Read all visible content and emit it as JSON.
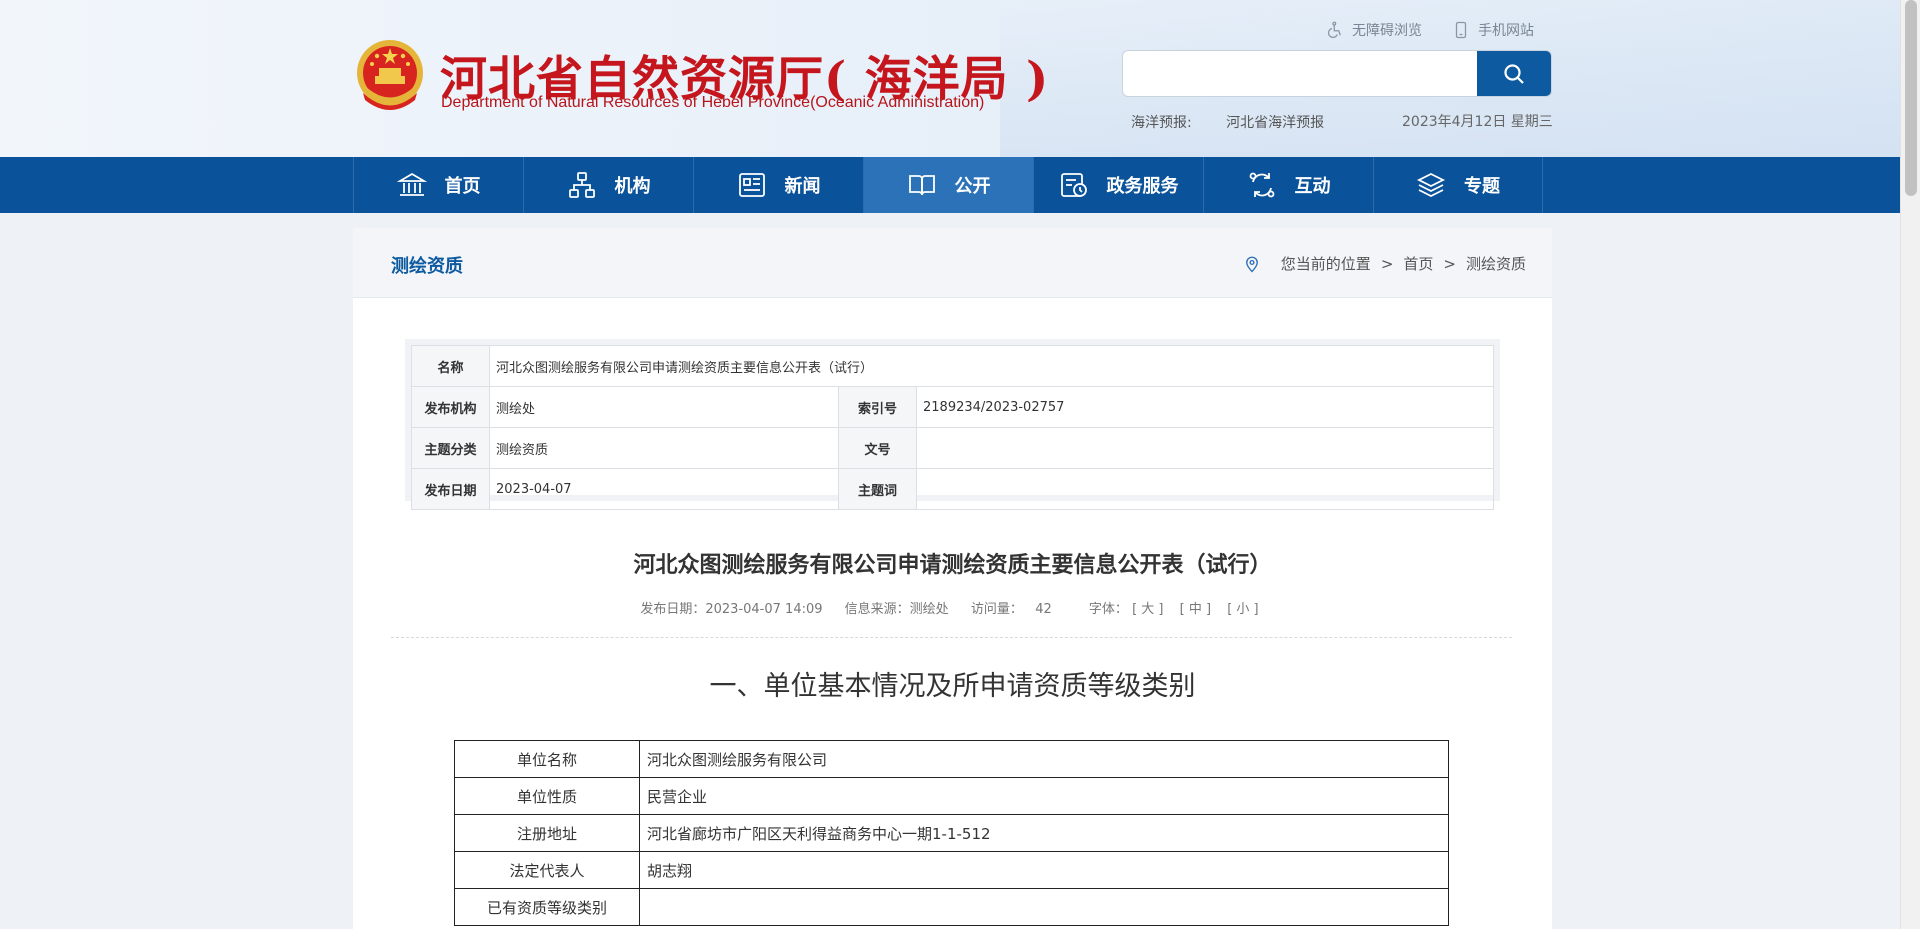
{
  "header": {
    "title": "河北省自然资源厅( 海洋局 )",
    "subtitle": "Department of Natural Resources of Hebei Province(Oceanic Administration)",
    "links": {
      "accessible": "无障碍浏览",
      "mobile": "手机网站"
    },
    "search": {
      "placeholder": ""
    },
    "forecast": {
      "label": "海洋预报:",
      "value": "河北省海洋预报"
    },
    "date": "2023年4月12日 星期三"
  },
  "nav": {
    "items": [
      {
        "label": "首页",
        "icon": "bank-icon"
      },
      {
        "label": "机构",
        "icon": "org-chart-icon"
      },
      {
        "label": "新闻",
        "icon": "newspaper-icon"
      },
      {
        "label": "公开",
        "icon": "open-book-icon"
      },
      {
        "label": "政务服务",
        "icon": "calendar-clock-icon"
      },
      {
        "label": "互动",
        "icon": "exchange-icon"
      },
      {
        "label": "专题",
        "icon": "layers-icon"
      }
    ],
    "active": "公开"
  },
  "breadcrumb": {
    "section_title": "测绘资质",
    "prefix": "您当前的位置",
    "sep": ">",
    "home": "首页",
    "current": "测绘资质"
  },
  "meta": {
    "name_label": "名称",
    "name_value": "河北众图测绘服务有限公司申请测绘资质主要信息公开表（试行）",
    "publisher_label": "发布机构",
    "publisher_value": "测绘处",
    "index_label": "索引号",
    "index_value": "2189234/2023-02757",
    "category_label": "主题分类",
    "category_value": "测绘资质",
    "docno_label": "文号",
    "docno_value": "",
    "date_label": "发布日期",
    "date_value": "2023-04-07",
    "keyword_label": "主题词",
    "keyword_value": ""
  },
  "article": {
    "title": "河北众图测绘服务有限公司申请测绘资质主要信息公开表（试行）",
    "publish": "发布日期：2023-04-07 14:09",
    "source": "信息来源：测绘处",
    "views_label": "访问量：",
    "views": "42",
    "font_label": "字体：",
    "font_large": "[ 大 ]",
    "font_medium": "[ 中 ]",
    "font_small": "[ 小 ]",
    "section1": "一、单位基本情况及所申请资质等级类别",
    "table": [
      {
        "k": "单位名称",
        "v": "河北众图测绘服务有限公司"
      },
      {
        "k": "单位性质",
        "v": "民营企业"
      },
      {
        "k": "注册地址",
        "v": "河北省廊坊市广阳区天利得益商务中心一期1-1-512"
      },
      {
        "k": "法定代表人",
        "v": "胡志翔"
      },
      {
        "k": "已有资质等级类别",
        "v": ""
      }
    ]
  },
  "colors": {
    "brand_red": "#c4161c",
    "nav_blue": "#0a5299",
    "nav_active": "#2b72b8",
    "link_blue": "#0d5aa0"
  }
}
